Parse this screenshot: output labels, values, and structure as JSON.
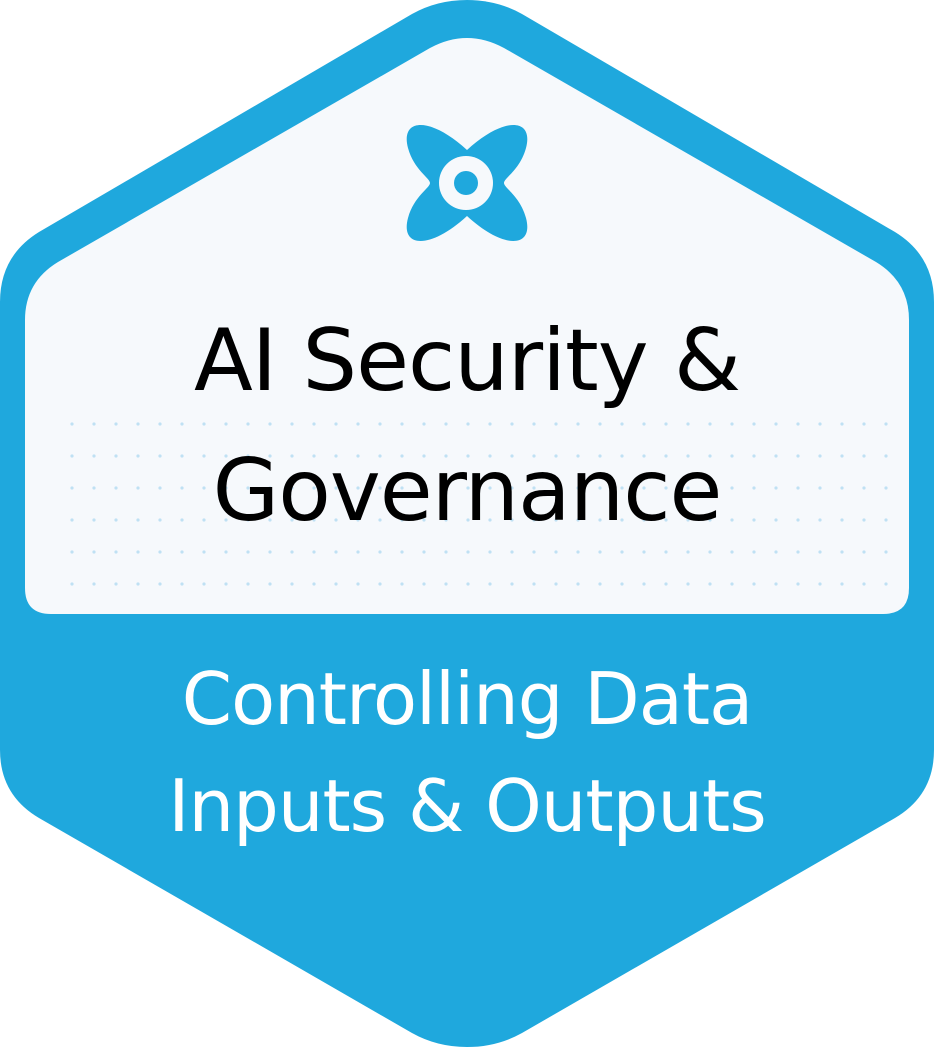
{
  "badge": {
    "title_line1": "AI Security &",
    "title_line2": "Governance",
    "subtitle_line1": "Controlling Data",
    "subtitle_line2": "Inputs & Outputs"
  },
  "colors": {
    "accent": "#1fa8dd",
    "panel": "#f6f9fc",
    "dots": "#b9def2",
    "title_text": "#000000",
    "subtitle_text": "#ffffff"
  },
  "icons": {
    "top_logo": "quatrefoil-ring-icon"
  }
}
